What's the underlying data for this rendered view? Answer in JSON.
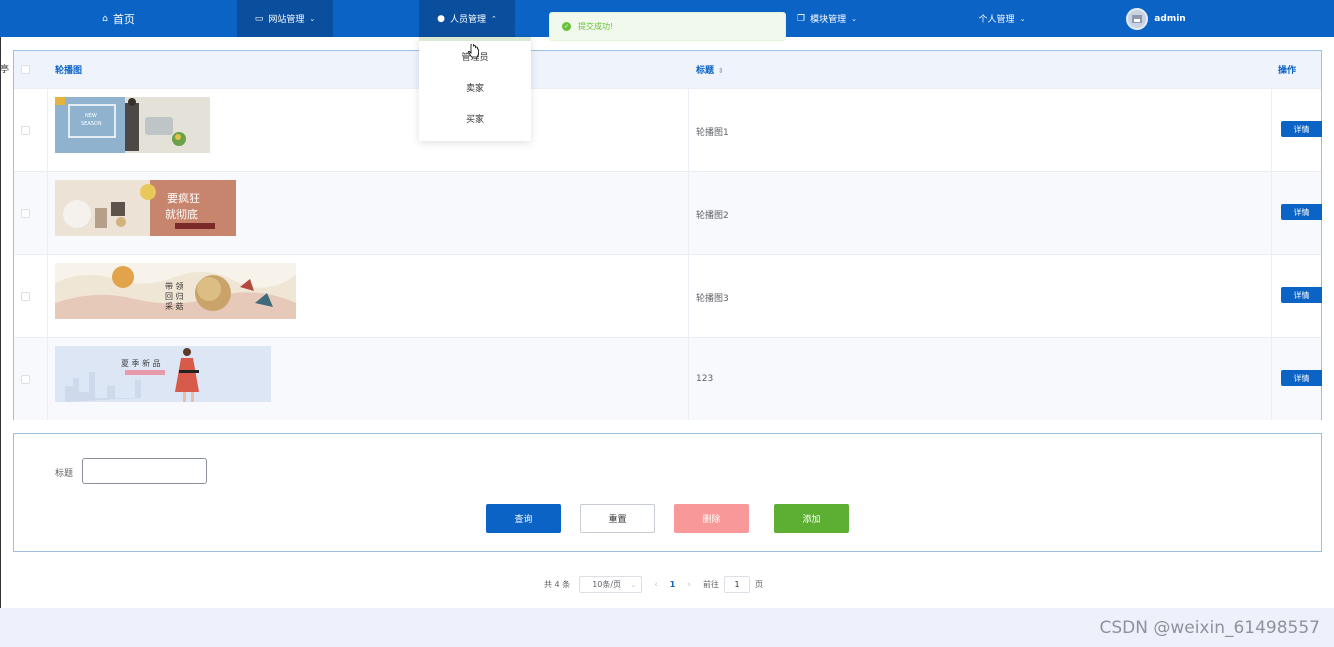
{
  "nav": {
    "home": "首页",
    "website_mgmt": "网站管理",
    "people_mgmt": "人员管理",
    "module_mgmt": "模块管理",
    "personal_mgmt": "个人管理",
    "user": "admin",
    "active_color": "#0a4f9e",
    "bar_color": "#0b63c5"
  },
  "toast": {
    "message": "提交成功!",
    "color": "#67c23a"
  },
  "people_menu": [
    "管理员",
    "卖家",
    "买家"
  ],
  "table": {
    "headers": {
      "image": "轮播图",
      "title": "标题",
      "operation": "操作"
    },
    "rows": [
      {
        "title": "轮播图1",
        "action": "详情"
      },
      {
        "title": "轮播图2",
        "action": "详情"
      },
      {
        "title": "轮播图3",
        "action": "详情"
      },
      {
        "title": "123",
        "action": "详情"
      }
    ]
  },
  "search": {
    "title_label": "标题",
    "title_value": "",
    "buttons": {
      "query": "查询",
      "reset": "重置",
      "delete": "删除",
      "add": "添加"
    }
  },
  "pagination": {
    "total_text": "共 4 条",
    "page_size": "10条/页",
    "current_page": "1",
    "goto_label": "前往",
    "goto_value": "1",
    "page_suffix": "页"
  },
  "watermark": "CSDN @weixin_61498557",
  "stray_char": "亭"
}
